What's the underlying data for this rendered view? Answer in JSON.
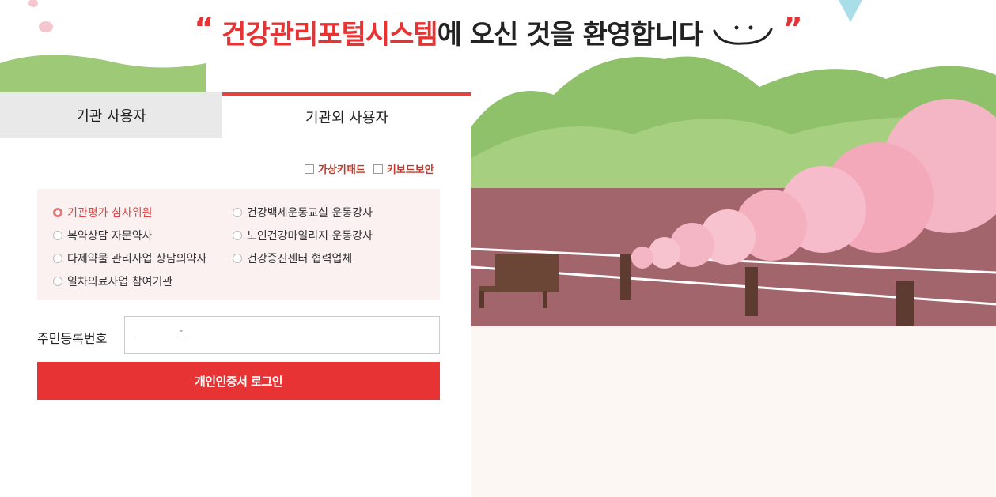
{
  "header": {
    "quote_open": "“",
    "brand": "건강관리포털시스템",
    "rest": "에 오신 것을 환영합니다",
    "quote_close": "”"
  },
  "tabs": [
    {
      "label": "기관 사용자",
      "active": false
    },
    {
      "label": "기관외 사용자",
      "active": true
    }
  ],
  "options": {
    "virtual_keypad": "가상키패드",
    "keyboard_security": "키보드보안"
  },
  "roles": [
    {
      "label": "기관평가 심사위원",
      "selected": true
    },
    {
      "label": "건강백세운동교실 운동강사",
      "selected": false
    },
    {
      "label": "복약상담 자문약사",
      "selected": false
    },
    {
      "label": "노인건강마일리지 운동강사",
      "selected": false
    },
    {
      "label": "다제약물 관리사업 상담의약사",
      "selected": false
    },
    {
      "label": "건강증진센터 협력업체",
      "selected": false
    },
    {
      "label": "일차의료사업 참여기관",
      "selected": false
    }
  ],
  "form": {
    "rrn_label": "주민등록번호",
    "rrn_placeholder": "______-_______",
    "login_button": "개인인증서 로그인"
  },
  "colors": {
    "accent": "#e73334",
    "tab_inactive_bg": "#e9e9e9",
    "role_box_bg": "#fbf1f0"
  }
}
